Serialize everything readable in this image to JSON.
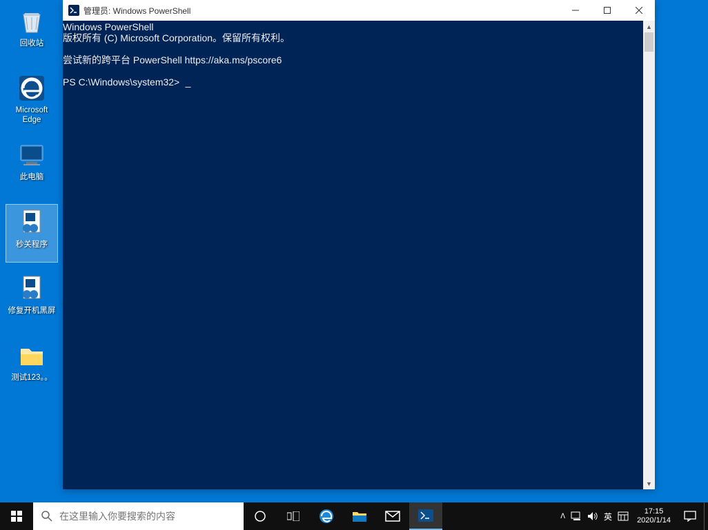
{
  "desktop": {
    "icons": [
      {
        "label": "回收站",
        "name": "recycle-bin"
      },
      {
        "label": "Microsoft\nEdge",
        "name": "microsoft-edge"
      },
      {
        "label": "此电脑",
        "name": "this-pc"
      },
      {
        "label": "秒关程序",
        "name": "seckill-program",
        "selected": true
      },
      {
        "label": "修复开机黑屏",
        "name": "fix-blackscreen"
      },
      {
        "label": "测试123。。",
        "name": "test123"
      }
    ]
  },
  "powershell": {
    "title": "管理员: Windows PowerShell",
    "lines": [
      "Windows PowerShell",
      "版权所有 (C) Microsoft Corporation。保留所有权利。",
      "",
      "尝试新的跨平台 PowerShell https://aka.ms/pscore6",
      "",
      "PS C:\\Windows\\system32>"
    ]
  },
  "taskbar": {
    "search_placeholder": "在这里输入你要搜索的内容",
    "ime_lang": "英",
    "time": "17:15",
    "date": "2020/1/14"
  }
}
